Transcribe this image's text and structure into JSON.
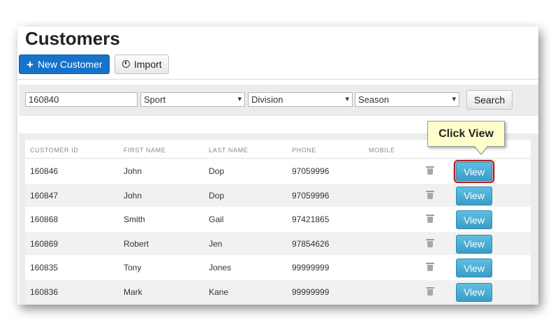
{
  "page": {
    "title": "Customers"
  },
  "toolbar": {
    "new_label": "New Customer",
    "new_icon": "plus-icon",
    "import_label": "Import",
    "import_icon": "import-icon"
  },
  "filters": {
    "search_value": "160840",
    "sport": "Sport",
    "division": "Division",
    "season": "Season",
    "search_label": "Search"
  },
  "table": {
    "headers": [
      "CUSTOMER ID",
      "FIRST NAME",
      "LAST NAME",
      "PHONE",
      "MOBILE"
    ],
    "rows": [
      {
        "id": "160846",
        "first": "John",
        "last": "Dop",
        "phone": "97059996",
        "mobile": "",
        "action": "View"
      },
      {
        "id": "160847",
        "first": "John",
        "last": "Dop",
        "phone": "97059996",
        "mobile": "",
        "action": "View"
      },
      {
        "id": "160868",
        "first": "Smith",
        "last": "Gail",
        "phone": "97421865",
        "mobile": "",
        "action": "View"
      },
      {
        "id": "160869",
        "first": "Robert",
        "last": "Jen",
        "phone": "97854626",
        "mobile": "",
        "action": "View"
      },
      {
        "id": "160835",
        "first": "Tony",
        "last": "Jones",
        "phone": "99999999",
        "mobile": "",
        "action": "View"
      },
      {
        "id": "160836",
        "first": "Mark",
        "last": "Kane",
        "phone": "99999999",
        "mobile": "",
        "action": "View"
      }
    ]
  },
  "callout": {
    "text": "Click View"
  },
  "colors": {
    "primary": "#1673c9",
    "view_button": "#3a9cc8",
    "highlight": "#b01c1c",
    "callout_bg": "#ffffcc"
  }
}
